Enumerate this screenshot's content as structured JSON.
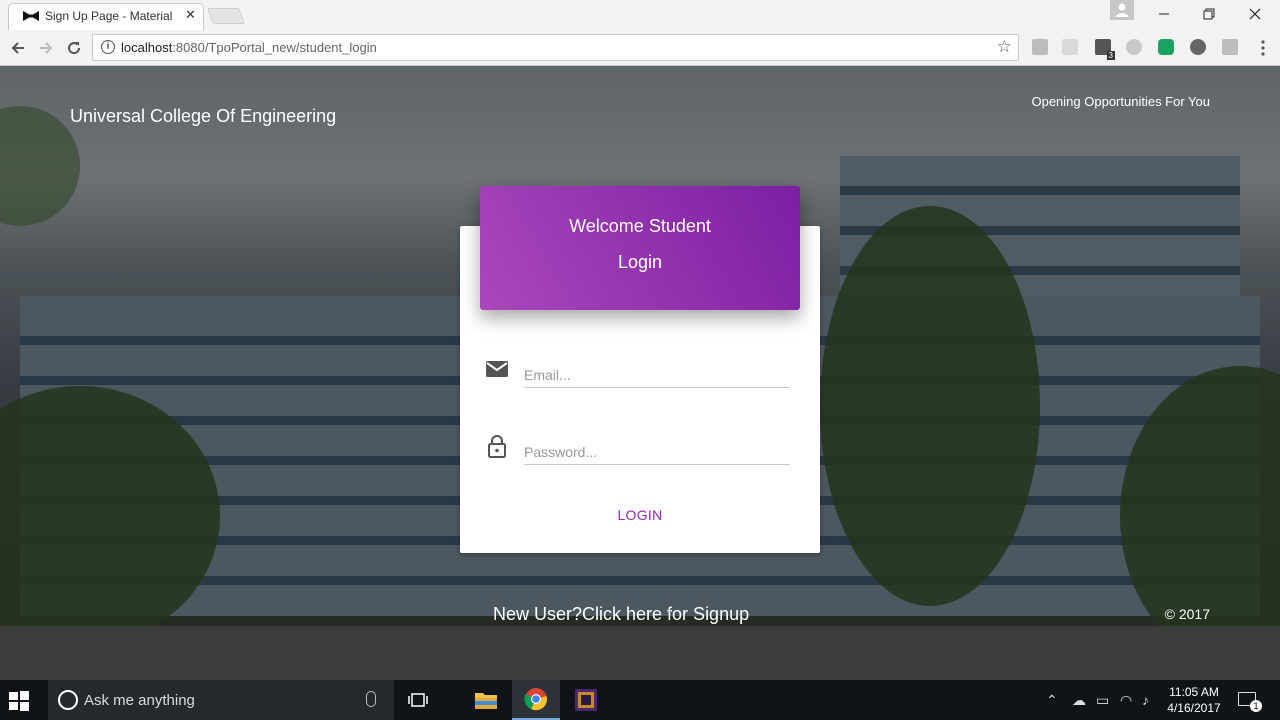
{
  "browser": {
    "tab_title": "Sign Up Page - Material Kit",
    "url_host": "localhost",
    "url_path": ":8080/TpoPortal_new/student_login",
    "extension_badge": "3"
  },
  "page": {
    "brand": "Universal College Of Engineering",
    "tagline": "Opening Opportunities For You",
    "card_title_line1": "Welcome Student",
    "card_title_line2": "Login",
    "email_placeholder": "Email...",
    "password_placeholder": "Password...",
    "login_label": "LOGIN",
    "signup_link": "New User?Click here for Signup",
    "copyright": "© 2017"
  },
  "taskbar": {
    "search_placeholder": "Ask me anything",
    "time": "11:05 AM",
    "date": "4/16/2017",
    "notification_count": "1"
  },
  "colors": {
    "accent_purple": "#9c27b0",
    "header_gradient_start": "#ab47bc",
    "header_gradient_end": "#7b1fa2"
  }
}
